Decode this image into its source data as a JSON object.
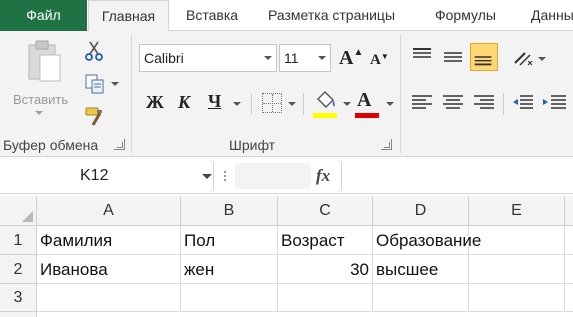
{
  "tabs": {
    "file": "Файл",
    "home": "Главная",
    "insert": "Вставка",
    "layout": "Разметка страницы",
    "formulas": "Формулы",
    "data": "Данны"
  },
  "ribbon": {
    "clipboard": {
      "paste_label": "Вставить",
      "group_label": "Буфер обмена"
    },
    "font": {
      "font_name": "Calibri",
      "font_size": "11",
      "grow_glyph": "A",
      "shrink_glyph": "A",
      "bold_glyph": "Ж",
      "italic_glyph": "К",
      "underline_glyph": "Ч",
      "font_color_glyph": "A",
      "group_label": "Шрифт",
      "fill_color": "#ffff00",
      "font_color": "#e00000"
    },
    "alignment": {
      "active_button": "align-bottom"
    }
  },
  "formula_bar": {
    "name_box": "K12",
    "fx_label": "fx",
    "formula_value": ""
  },
  "sheet": {
    "columns": [
      "A",
      "B",
      "C",
      "D",
      "E"
    ],
    "rows": [
      {
        "header": "1",
        "cells": [
          "Фамилия",
          "Пол",
          "Возраст",
          "Образование",
          ""
        ]
      },
      {
        "header": "2",
        "cells": [
          "Иванова",
          "жен",
          "30",
          "высшее",
          ""
        ]
      },
      {
        "header": "3",
        "cells": [
          "",
          "",
          "",
          "",
          ""
        ]
      }
    ]
  },
  "colors": {
    "file_tab": "#1f7244",
    "ribbon_bg": "#f3f3f3",
    "active_align": "#fcd774"
  }
}
